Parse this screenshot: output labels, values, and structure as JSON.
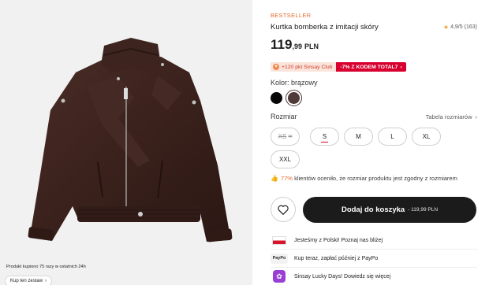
{
  "gallery": {
    "image_alt": "Kurtka bomberka z imitacji skóry",
    "popularity_note": "Produkt kupiono 75 razy w ostatnich 24h",
    "shop_set_label": "Kup ten zestaw",
    "shop_set_icon": "chevron-right-icon"
  },
  "product": {
    "badge": "BESTSELLER",
    "title": "Kurtka bomberka z imitacji skóry",
    "rating": {
      "score": "4,9/5",
      "count": "(163)",
      "icon": "star-icon",
      "color": "#e8a33a"
    },
    "price": {
      "integer": "119",
      "decimal": ",99",
      "currency": "PLN"
    },
    "promo": {
      "club_points": "+120 pkt Sinsay Club",
      "code_text": "-7% Z KODEM TOTAL7",
      "code_color": "#d8002f"
    },
    "color": {
      "label": "Kolor: brązowy",
      "swatches": [
        {
          "name": "czarny",
          "hex": "#070707"
        },
        {
          "name": "brązowy",
          "hex": "#4e3a38",
          "selected": true
        }
      ]
    },
    "size": {
      "label": "Rozmiar",
      "table_link": "Tabela rozmiarów",
      "options": [
        {
          "label": "XS",
          "available": false
        },
        {
          "label": "S",
          "available": true
        },
        {
          "label": "M",
          "available": true
        },
        {
          "label": "L",
          "available": true
        },
        {
          "label": "XL",
          "available": true
        },
        {
          "label": "XXL",
          "available": true
        }
      ]
    },
    "fit_note": {
      "percent": "77%",
      "text": "klientów oceniło, że rozmiar produktu jest zgodny z rozmiarem"
    },
    "actions": {
      "add_to_cart": "Dodaj do koszyka",
      "add_to_cart_price": "- 119,99 PLN",
      "favorite_icon": "heart-icon"
    },
    "info": [
      {
        "icon": "poland-flag-icon",
        "text": "Jesteśmy z Polski! Poznaj nas bliżej"
      },
      {
        "icon": "paypo-icon",
        "icon_text": "PayPo",
        "text": "Kup teraz, zapłać później z PayPo"
      },
      {
        "icon": "gift-icon",
        "text": "Sinsay Lucky Days! Dowiedz się więcej"
      }
    ]
  }
}
